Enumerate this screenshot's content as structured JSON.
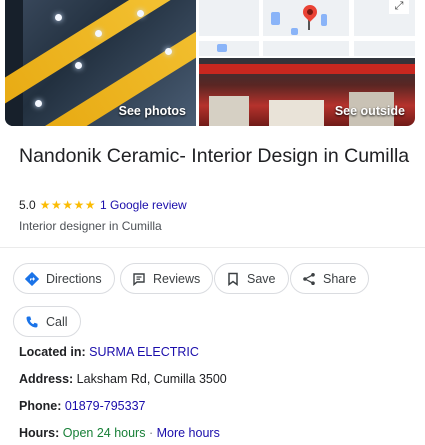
{
  "hero": {
    "see_photos_label": "See photos",
    "see_outside_label": "See outside"
  },
  "business": {
    "name": "Nandonik Ceramic- Interior Design in Cumilla",
    "rating": "5.0",
    "stars": "★★★★★",
    "review_link": "1 Google review",
    "category": "Interior designer in Cumilla"
  },
  "actions": {
    "directions": "Directions",
    "reviews": "Reviews",
    "save": "Save",
    "share": "Share",
    "call": "Call"
  },
  "details": {
    "located_in_label": "Located in:",
    "located_in_value": "SURMA ELECTRIC",
    "address_label": "Address:",
    "address_value": "Laksham Rd, Cumilla 3500",
    "phone_label": "Phone:",
    "phone_value": "01879-795337",
    "hours_label": "Hours:",
    "hours_status": "Open 24 hours",
    "hours_separator": "·",
    "hours_more": "More hours"
  },
  "colors": {
    "link": "#1a0dab",
    "open": "#188038",
    "star": "#fbbc04",
    "chip_border": "#dadce0"
  },
  "icons": [
    "directions-icon",
    "reviews-icon",
    "bookmark-icon",
    "share-icon",
    "phone-icon",
    "expand-map-icon",
    "map-pin-icon"
  ]
}
